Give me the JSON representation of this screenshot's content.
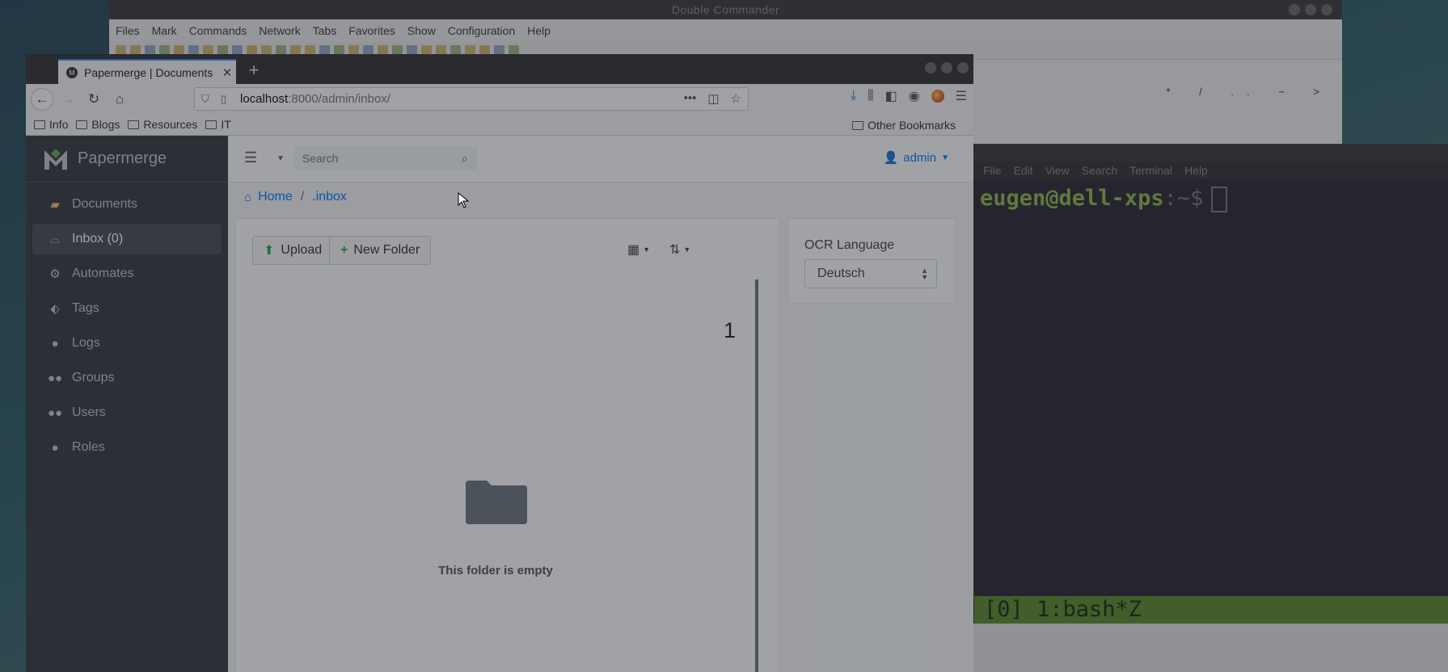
{
  "double_commander": {
    "title": "Double Commander",
    "menu": [
      "Files",
      "Mark",
      "Commands",
      "Network",
      "Tabs",
      "Favorites",
      "Show",
      "Configuration",
      "Help"
    ],
    "path_buttons": "* / .. ~ >"
  },
  "terminal": {
    "menu": [
      "File",
      "Edit",
      "View",
      "Search",
      "Terminal",
      "Help"
    ],
    "prompt_user": "eugen@dell-xps",
    "prompt_path": ":~$",
    "status_line": "[0] 1:bash*Z"
  },
  "browser": {
    "tab_title": "Papermerge | Documents",
    "url_host": "localhost",
    "url_rest": ":8000/admin/inbox/",
    "bookmarks": [
      "Info",
      "Blogs",
      "Resources",
      "IT"
    ],
    "other_bookmarks": "Other Bookmarks"
  },
  "app": {
    "brand": "Papermerge",
    "sidebar": [
      {
        "label": "Documents",
        "icon": "folder-icon"
      },
      {
        "label": "Inbox (0)",
        "icon": "inbox-icon",
        "active": true
      },
      {
        "label": "Automates",
        "icon": "robot-icon"
      },
      {
        "label": "Tags",
        "icon": "tag-icon"
      },
      {
        "label": "Logs",
        "icon": "lightbulb-icon"
      },
      {
        "label": "Groups",
        "icon": "users-icon"
      },
      {
        "label": "Users",
        "icon": "user-group-icon"
      },
      {
        "label": "Roles",
        "icon": "user-icon"
      }
    ],
    "search_placeholder": "Search",
    "user": "admin",
    "breadcrumb": {
      "home": "Home",
      "current": ".inbox"
    },
    "buttons": {
      "upload": "Upload",
      "new_folder": "New Folder"
    },
    "count_label": "1",
    "empty_text": "This folder is empty",
    "ocr": {
      "label": "OCR Language",
      "selected": "Deutsch"
    }
  },
  "colors": {
    "sidebar_bg": "#343a40",
    "accent": "#007bff",
    "terminal_green": "#8fb84a"
  }
}
